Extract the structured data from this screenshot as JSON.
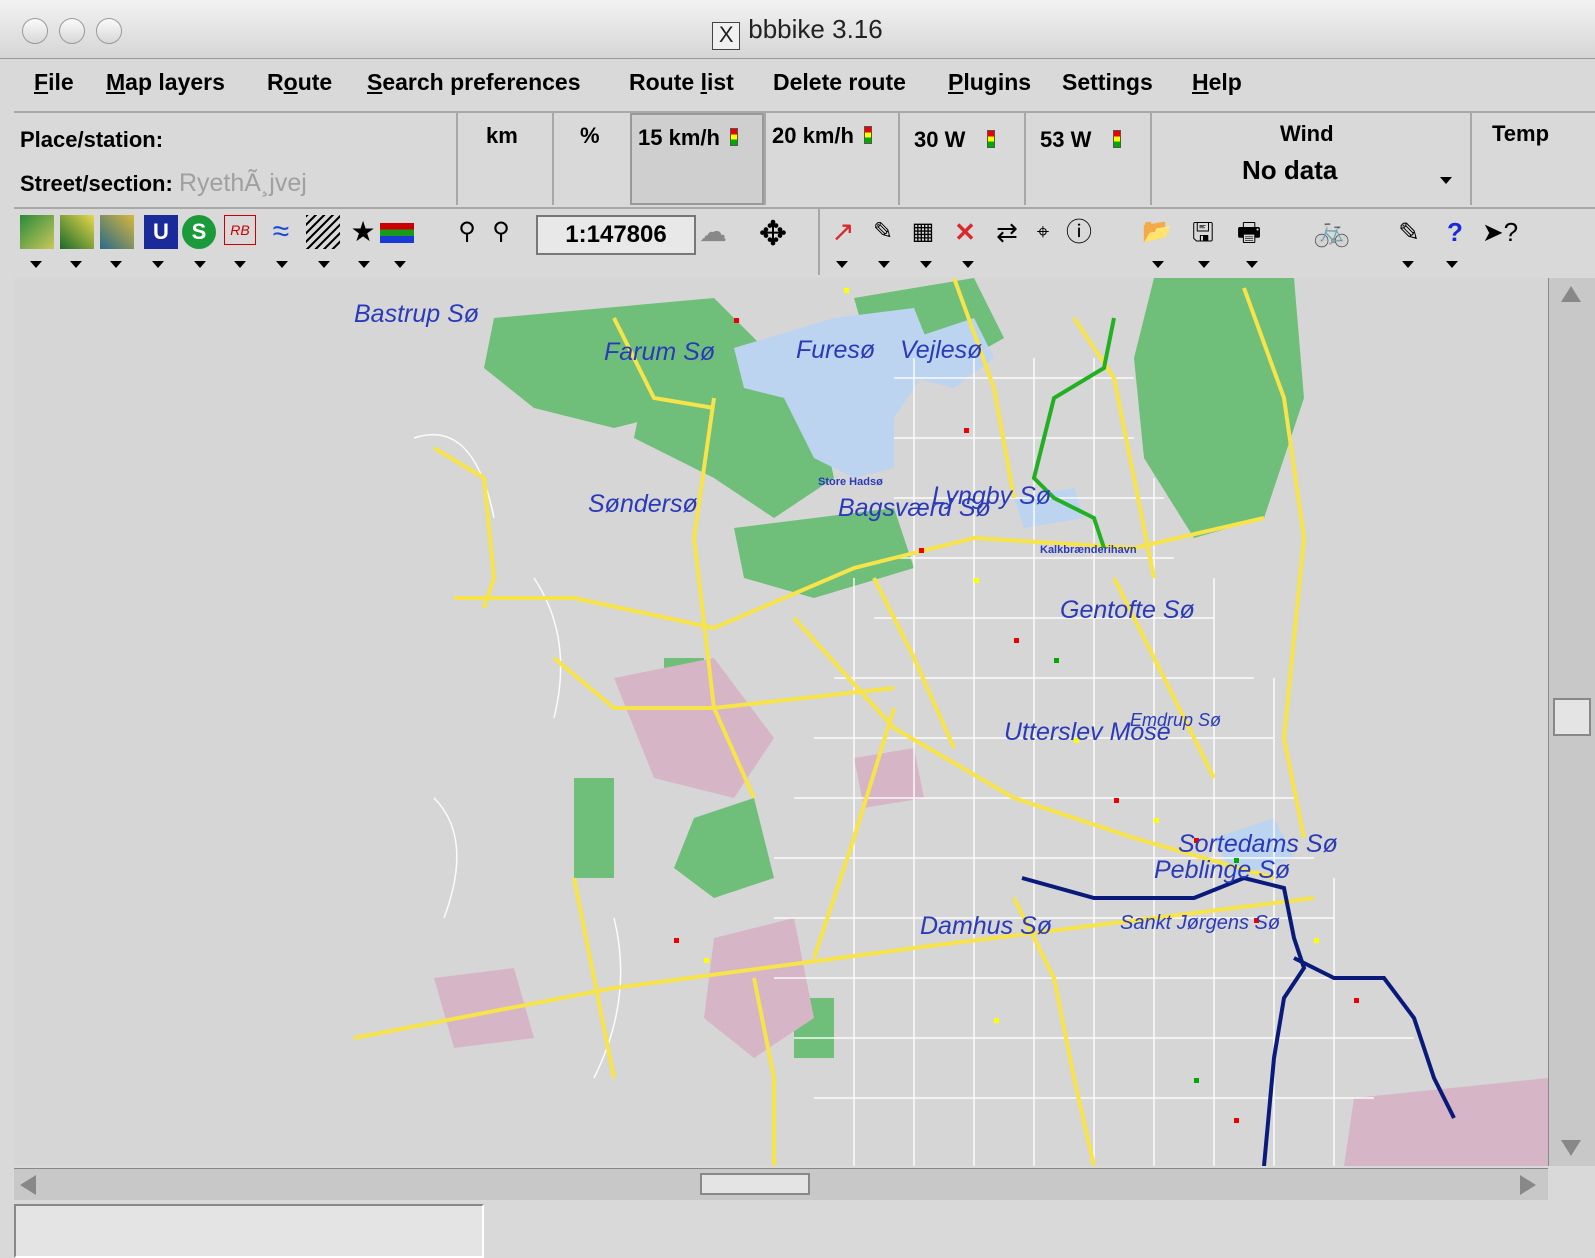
{
  "window": {
    "title": "bbbike 3.16",
    "x_logo": "X"
  },
  "menu": [
    {
      "label": "File",
      "u": "F",
      "rest": "ile"
    },
    {
      "label": "Map layers",
      "u": "M",
      "rest": "ap layers"
    },
    {
      "label": "Route",
      "pre": "R",
      "u": "o",
      "rest": "ute"
    },
    {
      "label": "Search preferences",
      "u": "S",
      "rest": "earch preferences"
    },
    {
      "label": "Route list",
      "pre": "Route ",
      "u": "l",
      "rest": "ist"
    },
    {
      "label": "Delete route",
      "pre": "Delete route",
      "u": "",
      "rest": ""
    },
    {
      "label": "Plugins",
      "u": "P",
      "rest": "lugins"
    },
    {
      "label": "Settings",
      "pre": "Settings",
      "u": "",
      "rest": ""
    },
    {
      "label": "Help",
      "u": "H",
      "rest": "elp"
    }
  ],
  "info": {
    "place_label": "Place/station:",
    "street_label": "Street/section:",
    "street_value": "RyethÃ¸jvej",
    "km": "km",
    "percent": "%",
    "speed1": "15 km/h",
    "speed2": "20 km/h",
    "power1": "30 W",
    "power2": "53 W",
    "wind_label": "Wind",
    "wind_value": "No data",
    "temp_label": "Temp"
  },
  "toolbar": {
    "scale": "1:147806"
  },
  "map": {
    "labels": [
      {
        "text": "Bastrup Sø"
      },
      {
        "text": "Farum Sø"
      },
      {
        "text": "Furesø"
      },
      {
        "text": "Vejlesø"
      },
      {
        "text": "Søndersø"
      },
      {
        "text": "Bagsværd Sø"
      },
      {
        "text": "Lyngby Sø"
      },
      {
        "text": "Gentofte Sø"
      },
      {
        "text": "Utterslev Mose"
      },
      {
        "text": "Emdrup Sø"
      },
      {
        "text": "Sortedams Sø"
      },
      {
        "text": "Peblinge Sø"
      },
      {
        "text": "Damhus Sø"
      },
      {
        "text": "Sankt Jørgens Sø"
      },
      {
        "text": "Store Hadsø"
      },
      {
        "text": "Kalkbrænderihavn"
      }
    ],
    "colors": {
      "water": "#bcd4f0",
      "forest": "#6fbf7a",
      "road": "#f7e34a",
      "route": "#0a1a7a",
      "green_route": "#22b022"
    }
  }
}
